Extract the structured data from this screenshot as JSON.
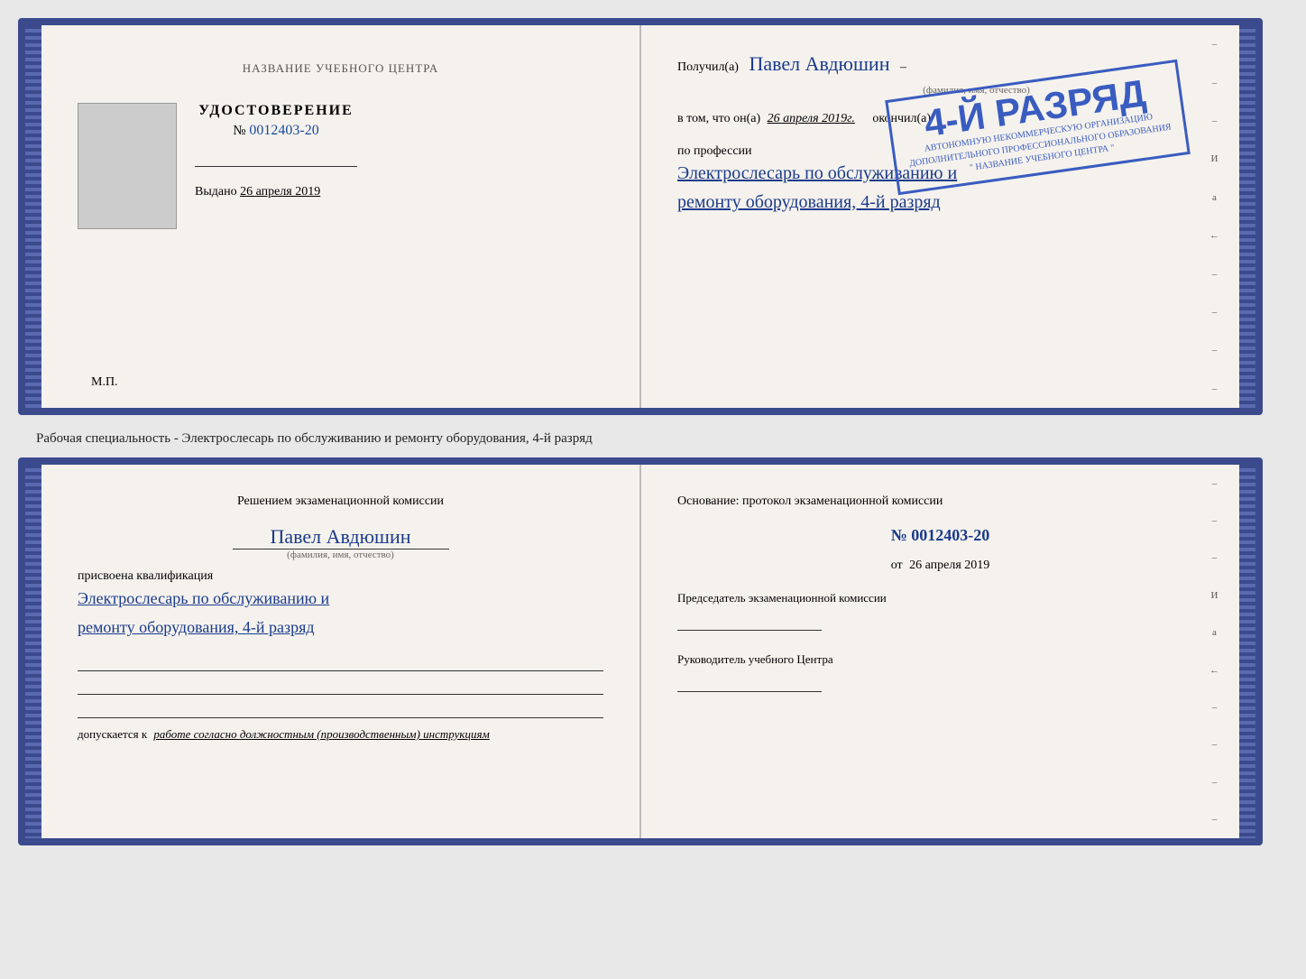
{
  "top_document": {
    "left": {
      "center_title": "НАЗВАНИЕ УЧЕБНОГО ЦЕНТРА",
      "cert_label": "УДОСТОВЕРЕНИЕ",
      "cert_number_prefix": "№",
      "cert_number": "0012403-20",
      "issued_label": "Выдано",
      "issued_date": "26 апреля 2019",
      "mp_label": "М.П."
    },
    "right": {
      "received_label": "Получил(а)",
      "received_name": "Павел Авдюшин",
      "fio_label": "(фамилия, имя, отчество)",
      "vtom_label": "в том, что он(а)",
      "vtom_date": "26 апреля 2019г.",
      "okonchil_label": "окончил(а)",
      "stamp_line1": "4-й разряд",
      "stamp_org1": "АВТОНОМНУЮ НЕКОММЕРЧЕСКУЮ ОРГАНИЗАЦИЮ",
      "stamp_org2": "ДОПОЛНИТЕЛЬНОГО ПРОФЕССИОНАЛЬНОГО ОБРАЗОВАНИЯ",
      "stamp_name": "\"  НАЗВАНИЕ УЧЕБНОГО ЦЕНТРА  \"",
      "profession_label": "по профессии",
      "profession_text1": "Электрослесарь по обслуживанию и",
      "profession_text2": "ремонту оборудования, 4-й разряд"
    }
  },
  "middle_text": "Рабочая специальность - Электрослесарь по обслуживанию и ремонту оборудования, 4-й разряд",
  "bottom_document": {
    "left": {
      "title": "Решением экзаменационной комиссии",
      "name": "Павел Авдюшин",
      "fio_label": "(фамилия, имя, отчество)",
      "prisvoena_label": "присвоена квалификация",
      "qual_line1": "Электрослесарь по обслуживанию и",
      "qual_line2": "ремонту оборудования, 4-й разряд",
      "допускается_label": "допускается к",
      "допускается_text": "работе согласно должностным (производственным) инструкциям"
    },
    "right": {
      "osnov_label": "Основание: протокол экзаменационной комиссии",
      "num_prefix": "№",
      "num_value": "0012403-20",
      "ot_prefix": "от",
      "ot_date": "26 апреля 2019",
      "chairman_label": "Председатель экзаменационной комиссии",
      "rukovoditel_label": "Руководитель учебного Центра"
    }
  },
  "side_marks": [
    "–",
    "–",
    "–",
    "И",
    "а",
    "←",
    "–",
    "–",
    "–",
    "–"
  ]
}
